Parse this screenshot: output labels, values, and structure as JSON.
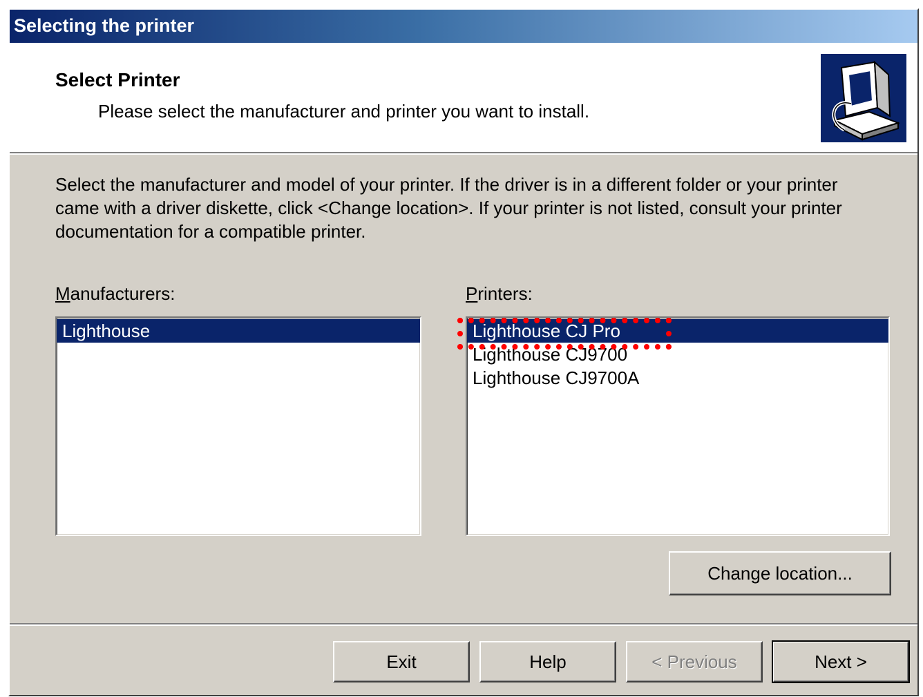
{
  "window": {
    "title": "Selecting the printer"
  },
  "header": {
    "title": "Select Printer",
    "subtitle": "Please select the manufacturer and printer you want to install.",
    "icon": "printer-setup-icon"
  },
  "intro": "Select the manufacturer and model of your printer. If the driver is in a different folder or your printer came with a driver diskette, click <Change location>. If your printer is not listed, consult your printer documentation for a compatible printer.",
  "manufacturers": {
    "label_accel": "M",
    "label_rest": "anufacturers:",
    "items": [
      "Lighthouse"
    ],
    "selected_index": 0
  },
  "printers": {
    "label_accel": "P",
    "label_rest": "rinters:",
    "items": [
      "Lighthouse CJ Pro",
      "Lighthouse CJ9700",
      "Lighthouse CJ9700A"
    ],
    "selected_index": 0
  },
  "buttons": {
    "change_location": "Change location...",
    "exit": "Exit",
    "help": "Help",
    "previous": "< Previous",
    "next": "Next >"
  },
  "colors": {
    "selection": "#0a246a",
    "highlight_outline": "#ff0000",
    "dialog_face": "#d4d0c8"
  }
}
